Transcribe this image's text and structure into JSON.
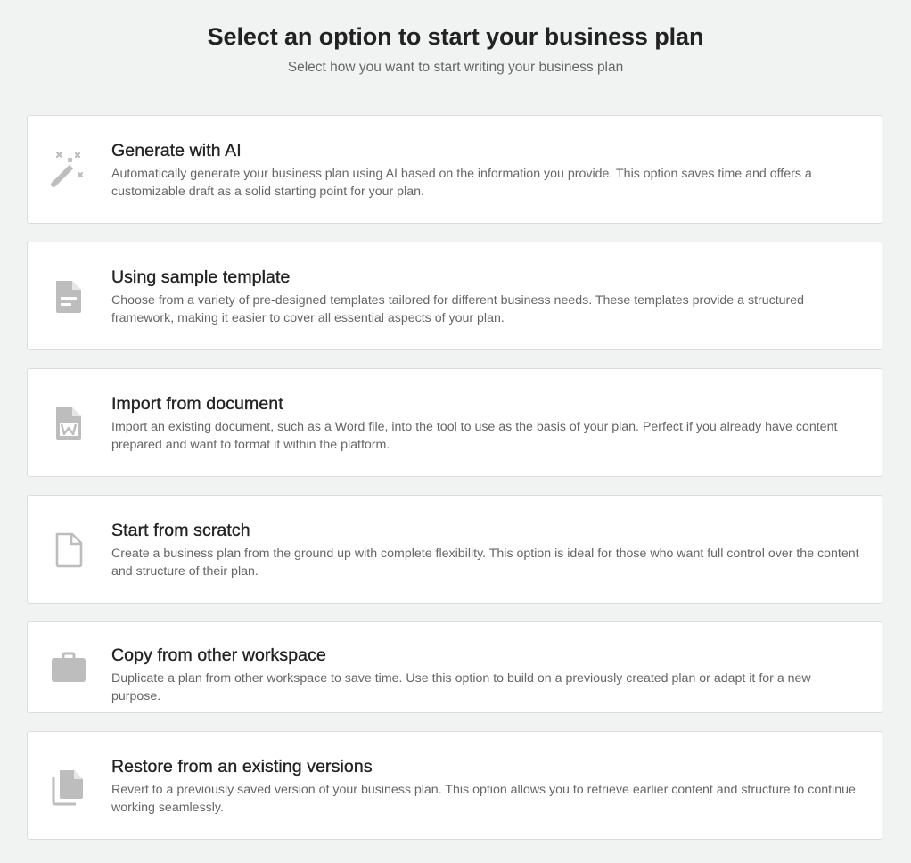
{
  "header": {
    "title": "Select an option to start your business plan",
    "subtitle": "Select how you want to start writing your business plan"
  },
  "options": [
    {
      "icon": "magic-wand-icon",
      "title": "Generate with AI",
      "description": "Automatically generate your business plan using AI based on the information you provide. This option saves time and offers a customizable draft as a solid starting point for your plan."
    },
    {
      "icon": "document-icon",
      "title": "Using sample template",
      "description": "Choose from a variety of pre-designed templates tailored for different business needs. These templates provide a structured framework, making it easier to cover all essential aspects of your plan."
    },
    {
      "icon": "word-file-icon",
      "title": "Import from document",
      "description": "Import an existing document, such as a Word file, into the tool to use as the basis of your plan. Perfect if you already have content prepared and want to format it within the platform."
    },
    {
      "icon": "blank-file-icon",
      "title": "Start from scratch",
      "description": "Create a business plan from the ground up with complete flexibility. This option is ideal for those who want full control over the content and structure of their plan."
    },
    {
      "icon": "briefcase-icon",
      "title": "Copy from other workspace",
      "description": "Duplicate a plan from other workspace to save time. Use this option to build on a previously created plan or adapt it for a new purpose."
    },
    {
      "icon": "file-copies-icon",
      "title": "Restore from an existing versions",
      "description": "Revert to a previously saved version of your business plan. This option allows you to retrieve earlier content and structure to continue working seamlessly."
    }
  ],
  "colors": {
    "background": "#f1f2f2",
    "card": "#ffffff",
    "icon": "#bdbdbd",
    "title": "#222222",
    "description": "#666666"
  }
}
